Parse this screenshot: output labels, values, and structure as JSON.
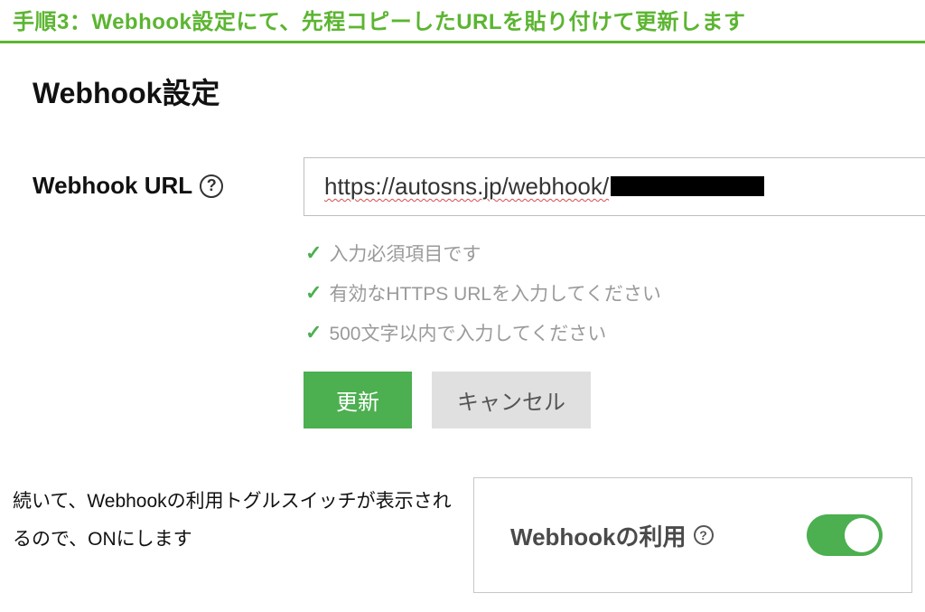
{
  "step_header": "手順3：Webhook設定にて、先程コピーしたURLを貼り付けて更新します",
  "section_title": "Webhook設定",
  "form": {
    "label": "Webhook URL",
    "url_visible": "https://autosns.jp/webhook/",
    "validations": [
      "入力必須項目です",
      "有効なHTTPS URLを入力してください",
      "500文字以内で入力してください"
    ],
    "update_button": "更新",
    "cancel_button": "キャンセル"
  },
  "instruction": "続いて、Webhookの利用トグルスイッチが表示されるので、ONにします",
  "toggle": {
    "label": "Webhookの利用",
    "state": "on"
  }
}
